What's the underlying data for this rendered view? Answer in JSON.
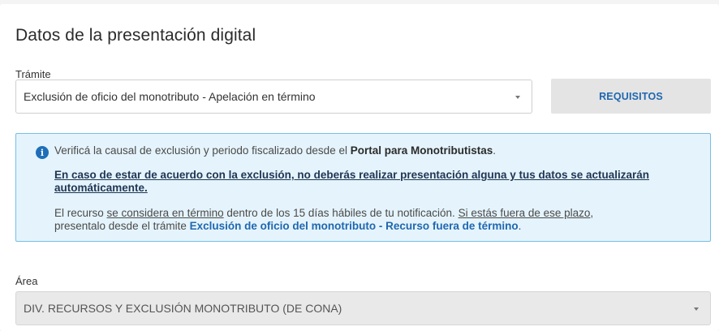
{
  "section": {
    "title": "Datos de la presentación digital"
  },
  "tramite": {
    "label": "Trámite",
    "selected": "Exclusión de oficio del monotributo - Apelación en término",
    "requisitos_label": "REQUISITOS"
  },
  "info": {
    "icon": "info-icon",
    "line1_prefix": "Verificá la causal de exclusión y periodo fiscalizado desde el ",
    "line1_link": "Portal para Monotributistas",
    "line1_suffix": ".",
    "notice": "En caso de estar de acuerdo con la exclusión, no deberás realizar presentación alguna y tus datos se actualizarán automáticamente.",
    "p3_a": "El recurso ",
    "p3_link1": "se considera en término",
    "p3_b": " dentro de los 15 días hábiles de tu notificación. ",
    "p3_link2": "Si estás fuera de ese plazo",
    "p3_c": ",",
    "p3_d": "presentalo desde el trámite ",
    "p3_link3": "Exclusión de oficio del monotributo - Recurso fuera de término",
    "p3_e": "."
  },
  "area": {
    "label": "Área",
    "selected": "DIV. RECURSOS Y EXCLUSIÓN MONOTRIBUTO (DE CONA)"
  },
  "colors": {
    "accent": "#1f67b0",
    "info_bg": "#e5f4fc",
    "info_border": "#75bfe6",
    "button_bg": "#e4e4e4"
  }
}
